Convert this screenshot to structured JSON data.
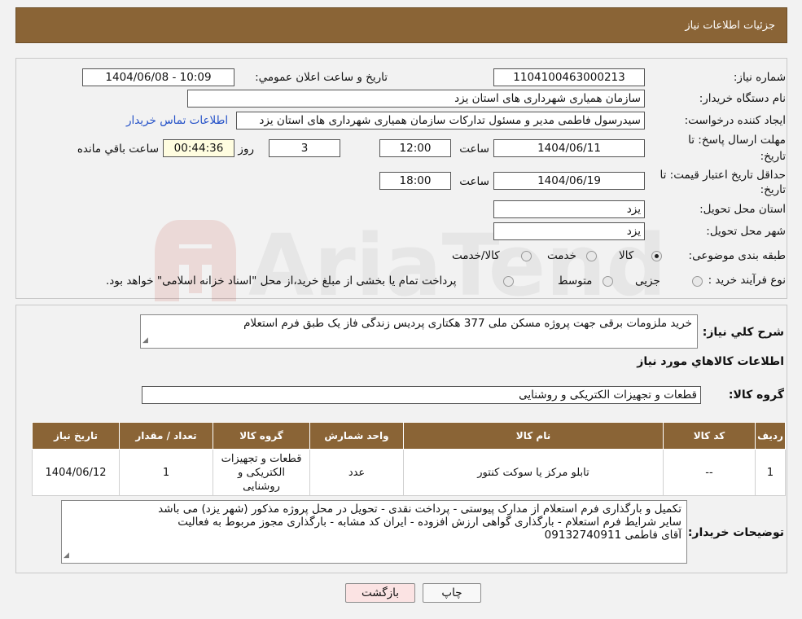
{
  "header": {
    "title": "جزئیات اطلاعات نیاز"
  },
  "watermark": {
    "text": "AriaTender.neT"
  },
  "info": {
    "need_number_label": "شماره نیاز:",
    "need_number": "1104100463000213",
    "announce_label": "تاریخ و ساعت اعلان عمومي:",
    "announce_value": "1404/06/08 - 10:09",
    "buyer_label": "نام دستگاه خریدار:",
    "buyer_value": "سازمان همیاری شهرداری های استان یزد",
    "creator_label": "ایجاد کننده درخواست:",
    "creator_value": "سیدرسول فاطمی مدیر و مسئول تدارکات سازمان همیاری شهرداری های استان یزد",
    "contact_link": "اطلاعات تماس خریدار",
    "deadline_label_1": "مهلت ارسال پاسخ: تا",
    "deadline_label_2": "تاریخ:",
    "deadline_date": "1404/06/11",
    "time_label": "ساعت",
    "deadline_time": "12:00",
    "days_value": "3",
    "days_label": "روز و",
    "remaining_value": "00:44:36",
    "remaining_label": "ساعت باقي مانده",
    "validity_label_1": "حداقل تاریخ اعتبار قیمت: تا",
    "validity_label_2": "تاریخ:",
    "validity_date": "1404/06/19",
    "validity_time": "18:00",
    "province_label": "استان محل تحویل:",
    "province_value": "یزد",
    "city_label": "شهر محل تحویل:",
    "city_value": "یزد",
    "category_label": "طبقه بندی موضوعی:",
    "category_options": [
      "کالا",
      "خدمت",
      "کالا/خدمت"
    ],
    "process_label": "نوع فرآیند خرید :",
    "process_options": [
      "جزیی",
      "متوسط"
    ],
    "process_note": "پرداخت تمام یا بخشی از مبلغ خرید،از محل \"اسناد خزانه اسلامی\" خواهد بود."
  },
  "summary": {
    "desc_label": "شرح کلي نیاز:",
    "desc_value": "خرید ملزومات برقی جهت پروژه مسکن ملی 377 هکتاری پردیس زندگی فاز یک طبق فرم استعلام",
    "goods_info_title": "اطلاعات کالاهاي مورد نیاز",
    "group_label": "گروه کالا:",
    "group_value": "قطعات و تجهیزات الکتریکی و روشنایی",
    "columns": [
      "ردیف",
      "کد کالا",
      "نام کالا",
      "واحد شمارش",
      "گروه کالا",
      "تعداد / مقدار",
      "تاریخ نیاز"
    ],
    "rows": [
      {
        "row": "1",
        "code": "--",
        "name": "تابلو مرکز یا سوکت کنتور",
        "unit": "عدد",
        "group": "قطعات و تجهیزات الکتریکی و روشنایی",
        "qty": "1",
        "date": "1404/06/12"
      }
    ],
    "buyer_notes_label": "توضیحات خریدار:",
    "buyer_notes": [
      "تکمیل و بارگذاری فرم استعلام از مدارک پیوستی - پرداخت نقدی - تحویل در محل پروژه مذکور (شهر یزد) می باشد",
      "سایر شرایط فرم استعلام - بارگذاری گواهی ارزش افزوده - ایران کد مشابه - بارگذاری مجوز مربوط به فعالیت",
      "آقای فاطمی 09132740911"
    ]
  },
  "buttons": {
    "print": "چاپ",
    "back": "بازگشت"
  },
  "colors": {
    "header_bg": "#8a6436",
    "link": "#2451c8",
    "back_btn": "#fbe3e3"
  }
}
